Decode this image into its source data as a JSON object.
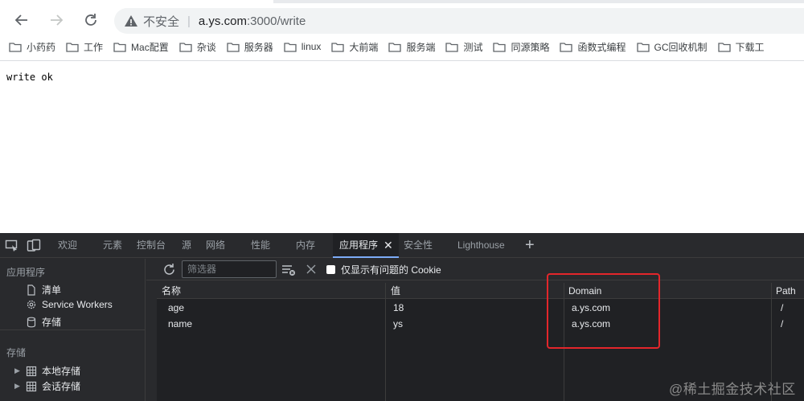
{
  "browser": {
    "url_insecure_label": "不安全",
    "url_host": "a.ys.com",
    "url_path": ":3000/write",
    "bookmarks": [
      "小药药",
      "工作",
      "Mac配置",
      "杂谈",
      "服务器",
      "linux",
      "大前端",
      "服务端",
      "测试",
      "同源策略",
      "函数式编程",
      "GC回收机制",
      "下载工"
    ]
  },
  "page": {
    "text": "write ok"
  },
  "devtools": {
    "tabs": [
      "欢迎",
      "元素",
      "控制台",
      "源",
      "网络",
      "性能",
      "内存",
      "应用程序",
      "安全性",
      "Lighthouse"
    ],
    "active_tab": "应用程序",
    "sidebar": {
      "app_heading": "应用程序",
      "app_items": [
        "清单",
        "Service Workers",
        "存储"
      ],
      "storage_heading": "存储",
      "storage_items": [
        "本地存储",
        "会话存储"
      ]
    },
    "toolbar": {
      "filter_placeholder": "筛选器",
      "only_issues_label": "仅显示有问题的 Cookie"
    },
    "cookies": {
      "columns": [
        "名称",
        "值",
        "Domain",
        "Path"
      ],
      "rows": [
        {
          "name": "age",
          "value": "18",
          "domain": "a.ys.com",
          "path": "/"
        },
        {
          "name": "name",
          "value": "ys",
          "domain": "a.ys.com",
          "path": "/"
        }
      ]
    }
  },
  "watermark": "@稀土掘金技术社区",
  "colors": {
    "devtools_bg": "#292a2d",
    "table_bg": "#202124",
    "highlight": "#e3262b",
    "active_tab_underline": "#7cacf8"
  }
}
